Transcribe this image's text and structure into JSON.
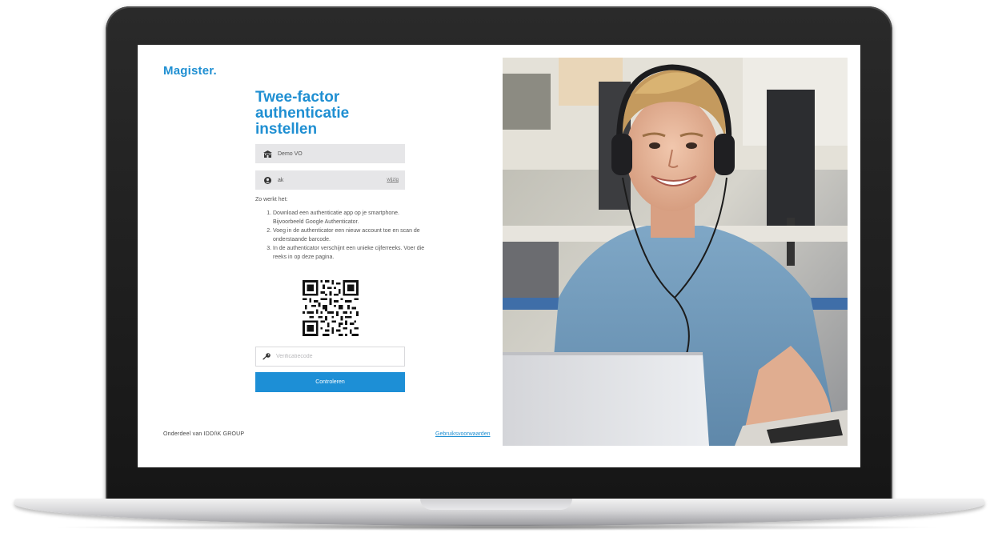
{
  "brand": {
    "logo": "Magister."
  },
  "page": {
    "title_lines": [
      "Twee-factor",
      "authenticatie",
      "instellen"
    ]
  },
  "school_field": {
    "icon": "school-building-icon",
    "value": "Demo VO"
  },
  "user_field": {
    "icon": "user-icon",
    "value": "ak",
    "change_link": "wijzig"
  },
  "instructions": {
    "heading": "Zo werkt het:",
    "steps": [
      "Download een authenticatie app op je smartphone. Bijvoorbeeld Google Authenticator.",
      "Voeg in de authenticator een nieuw account toe en scan de onderstaande barcode.",
      "In de authenticator verschijnt een unieke cijferreeks. Voer die reeks in op deze pagina."
    ]
  },
  "verification": {
    "icon": "key-icon",
    "placeholder": "Verificatiecode",
    "value": ""
  },
  "submit_button": {
    "label": "Controleren"
  },
  "footer": {
    "left": "Onderdeel van IDDI\\K GROUP",
    "right_link": "Gebruiksvoorwaarden"
  },
  "photo": {
    "description_icon": "student-with-headphones-photo"
  },
  "colors": {
    "brand_blue": "#1f8fd2",
    "button_blue": "#1d8fd6",
    "field_gray": "#e6e6e8",
    "laptop_bezel": "#1c1c1c"
  }
}
